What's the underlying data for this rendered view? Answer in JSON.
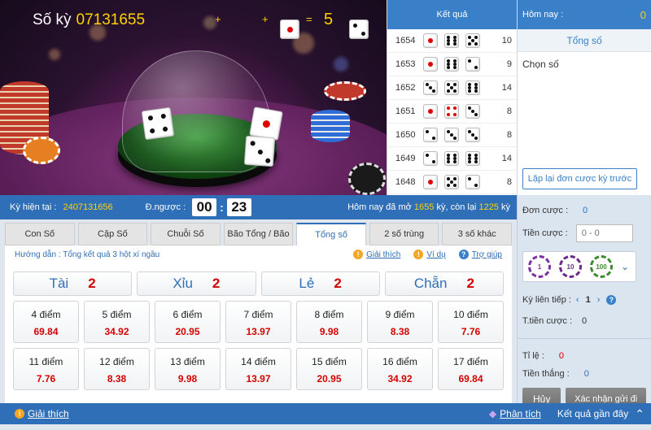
{
  "header": {
    "period_label": "Số kỳ",
    "period_number": "07131655",
    "plus1": "+",
    "plus2": "+",
    "equals": "=",
    "sum": "5"
  },
  "results": {
    "title": "Kết quả",
    "rows": [
      {
        "ky": "1654",
        "sum": "10"
      },
      {
        "ky": "1653",
        "sum": "9"
      },
      {
        "ky": "1652",
        "sum": "14"
      },
      {
        "ky": "1651",
        "sum": "8"
      },
      {
        "ky": "1650",
        "sum": "8"
      },
      {
        "ky": "1649",
        "sum": "14"
      },
      {
        "ky": "1648",
        "sum": "8"
      }
    ]
  },
  "today": {
    "title": "Hôm nay :",
    "count": "0",
    "tong_so": "Tổng số",
    "chon_so": "Chọn số",
    "repeat_button": "Lặp lại đơn cược kỳ trước"
  },
  "infobar": {
    "current_label": "Kỳ hiện tại :",
    "current_value": "2407131656",
    "countdown_label": "Đ.ngược :",
    "minutes": "00",
    "colon": ":",
    "seconds": "23",
    "opened_prefix": "Hôm nay đã mở",
    "opened_count": "1655",
    "opened_mid": "kỳ, còn lại",
    "remaining": "1225",
    "opened_suffix": "kỳ"
  },
  "tabs": [
    "Con Số",
    "Cặp Số",
    "Chuỗi Số",
    "Bão Tổng / Bão",
    "Tổng số",
    "2 số trùng",
    "3 số khác"
  ],
  "guide": {
    "text": "Hướng dẫn : Tổng kết quả 3 hột xí ngầu",
    "explain": "Giải thích",
    "example": "Ví dụ",
    "help": "Trợ giúp"
  },
  "big_bets": [
    {
      "label": "Tài",
      "ratio": "2"
    },
    {
      "label": "Xỉu",
      "ratio": "2"
    },
    {
      "label": "Lẻ",
      "ratio": "2"
    },
    {
      "label": "Chẵn",
      "ratio": "2"
    }
  ],
  "points_row1": [
    {
      "label": "4 điểm",
      "ratio": "69.84"
    },
    {
      "label": "5 điểm",
      "ratio": "34.92"
    },
    {
      "label": "6 điểm",
      "ratio": "20.95"
    },
    {
      "label": "7 điểm",
      "ratio": "13.97"
    },
    {
      "label": "8 điểm",
      "ratio": "9.98"
    },
    {
      "label": "9 điểm",
      "ratio": "8.38"
    },
    {
      "label": "10 điểm",
      "ratio": "7.76"
    }
  ],
  "points_row2": [
    {
      "label": "11 điểm",
      "ratio": "7.76"
    },
    {
      "label": "12 điểm",
      "ratio": "8.38"
    },
    {
      "label": "13 điểm",
      "ratio": "9.98"
    },
    {
      "label": "14 điểm",
      "ratio": "13.97"
    },
    {
      "label": "15 điểm",
      "ratio": "20.95"
    },
    {
      "label": "16 điểm",
      "ratio": "34.92"
    },
    {
      "label": "17 điểm",
      "ratio": "69.84"
    }
  ],
  "bet": {
    "order_label": "Đơn cược :",
    "order_value": "0",
    "amount_label": "Tiền cược :",
    "amount_placeholder": "0 - 0",
    "chips": [
      "1",
      "10",
      "100"
    ],
    "continuous_label": "Kỳ liên tiếp :",
    "continuous_value": "1",
    "total_label": "T.tiền cược :",
    "total_value": "0",
    "rate_label": "Tỉ lệ :",
    "rate_value": "0",
    "win_label": "Tiền thắng :",
    "win_value": "0",
    "cancel": "Hủy",
    "confirm": "Xác nhận gửi đi"
  },
  "footer": {
    "explain": "Giải thích",
    "analysis": "Phân tích",
    "recent": "Kết quả gần đây"
  },
  "colors": {
    "primary": "#2f6fb7",
    "accent": "#ffd200",
    "red": "#d40000"
  }
}
